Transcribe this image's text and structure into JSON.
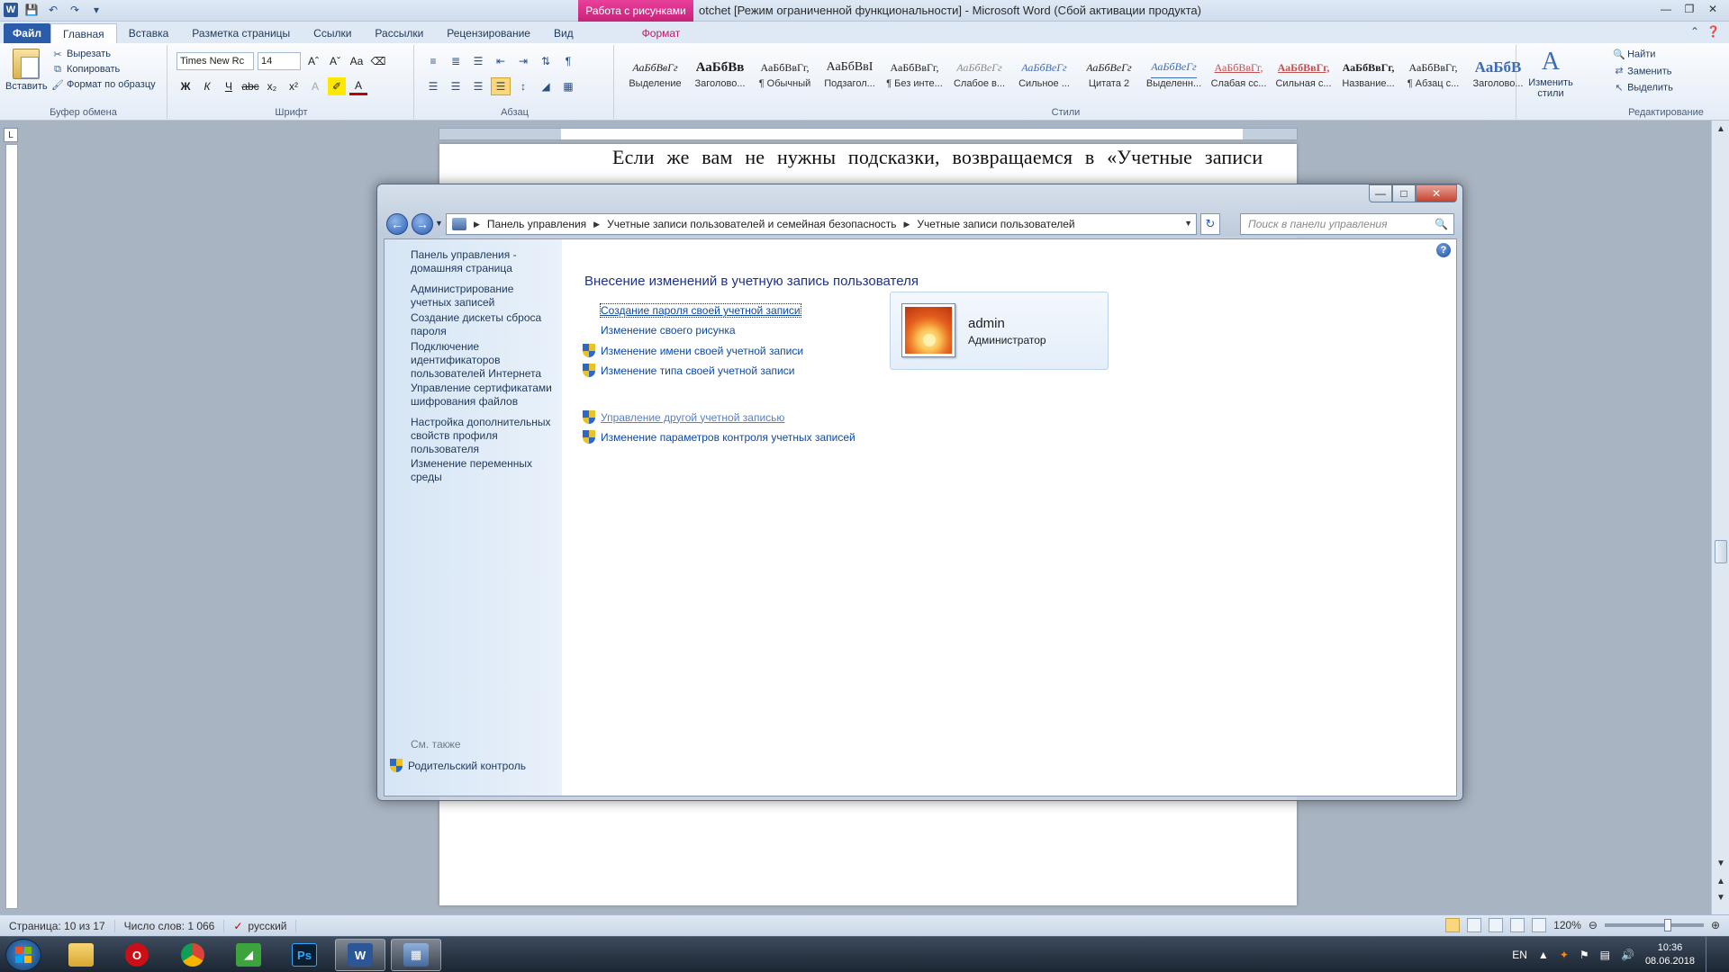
{
  "word": {
    "title": "otchet [Режим ограниченной функциональности]  -  Microsoft Word (Сбой активации продукта)",
    "context_tab_group": "Работа с рисунками",
    "tabs": [
      "Файл",
      "Главная",
      "Вставка",
      "Разметка страницы",
      "Ссылки",
      "Рассылки",
      "Рецензирование",
      "Вид",
      "Формат"
    ],
    "clipboard": {
      "paste": "Вставить",
      "cut": "Вырезать",
      "copy": "Копировать",
      "format_painter": "Формат по образцу",
      "group_label": "Буфер обмена"
    },
    "font": {
      "name": "Times New Rc",
      "size": "14",
      "group_label": "Шрифт"
    },
    "paragraph": {
      "group_label": "Абзац"
    },
    "styles": {
      "group_label": "Стили",
      "items": [
        {
          "sample": "АаБбВвГг",
          "name": "Выделение"
        },
        {
          "sample": "АаБбВв",
          "name": "Заголово..."
        },
        {
          "sample": "АаБбВвГг,",
          "name": "¶ Обычный"
        },
        {
          "sample": "АаБбВвI",
          "name": "Подзагол..."
        },
        {
          "sample": "АаБбВвГг,",
          "name": "¶ Без инте..."
        },
        {
          "sample": "АаБбВеГг",
          "name": "Слабое в..."
        },
        {
          "sample": "АаБбВеГг",
          "name": "Сильное ..."
        },
        {
          "sample": "АаБбВеГг",
          "name": "Цитата 2"
        },
        {
          "sample": "АаБбВеГг",
          "name": "Выделенн..."
        },
        {
          "sample": "АаБбВвГг,",
          "name": "Слабая сс..."
        },
        {
          "sample": "АаБбВвГг,",
          "name": "Сильная с..."
        },
        {
          "sample": "АаБбВвГг,",
          "name": "Название..."
        },
        {
          "sample": "АаБбВвГг,",
          "name": "¶ Абзац с..."
        },
        {
          "sample": "АаБбВ",
          "name": "Заголово..."
        }
      ],
      "change_styles": "Изменить стили"
    },
    "editing": {
      "find": "Найти",
      "replace": "Заменить",
      "select": "Выделить",
      "group_label": "Редактирование"
    },
    "document_text": "Если  же  вам  не  нужны  подсказки,  возвращаемся  в  «Учетные  записи",
    "status": {
      "page": "Страница: 10 из 17",
      "words": "Число слов: 1 066",
      "language": "русский",
      "zoom": "120%"
    }
  },
  "control_panel": {
    "breadcrumbs": [
      "Панель управления",
      "Учетные записи пользователей и семейная безопасность",
      "Учетные записи пользователей"
    ],
    "search_placeholder": "Поиск в панели управления",
    "left_nav": [
      "Панель управления - домашняя страница",
      "Администрирование учетных записей",
      "Создание дискеты сброса пароля",
      "Подключение идентификаторов пользователей Интернета",
      "Управление сертификатами шифрования файлов",
      "Настройка дополнительных свойств профиля пользователя",
      "Изменение переменных среды"
    ],
    "see_also": "См. также",
    "parental_control": "Родительский контроль",
    "heading": "Внесение изменений в учетную запись пользователя",
    "tasks": [
      "Создание пароля своей учетной записи",
      "Изменение своего рисунка",
      "Изменение имени своей учетной записи",
      "Изменение типа своей учетной записи",
      "Управление другой учетной записью",
      "Изменение параметров контроля учетных записей"
    ],
    "user": {
      "name": "admin",
      "role": "Администратор"
    }
  },
  "taskbar": {
    "lang": "EN",
    "time": "10:36",
    "date": "08.06.2018"
  },
  "colors": {
    "word_file_tab": "#2a5caa",
    "picture_tools": "#c8227a",
    "cp_heading": "#1e3287",
    "cp_link": "#0f4aa0"
  }
}
